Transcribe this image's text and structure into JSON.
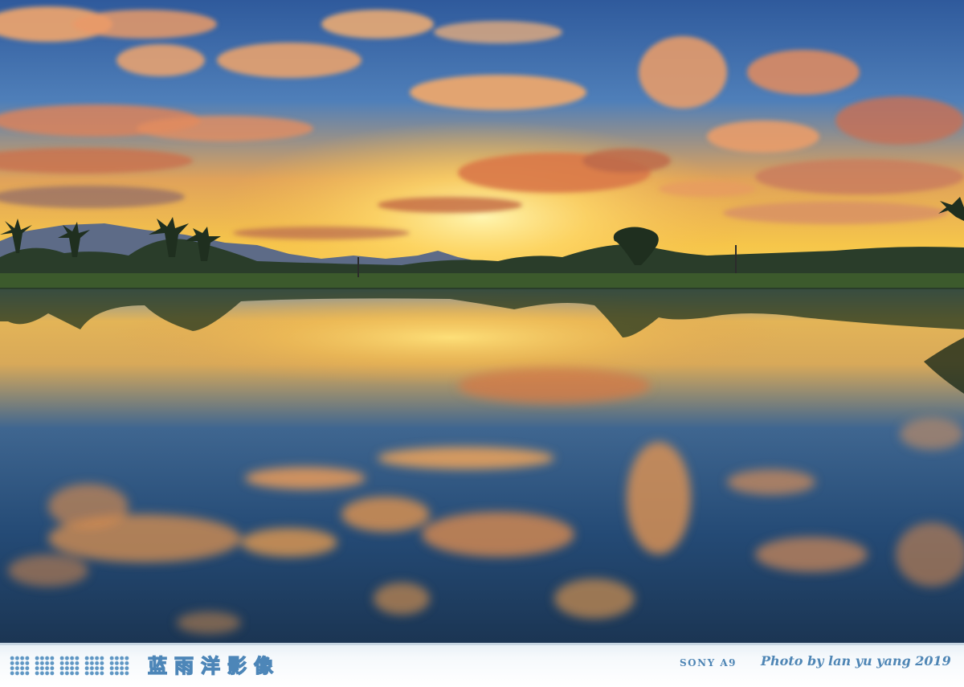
{
  "footer": {
    "studio_name": "蓝雨洋影像",
    "camera": "SONY A9",
    "credit": "Photo by lan yu yang 2019",
    "accent_color": "#4f86b5"
  },
  "photo": {
    "scene": "sunset-lake-reflection"
  }
}
